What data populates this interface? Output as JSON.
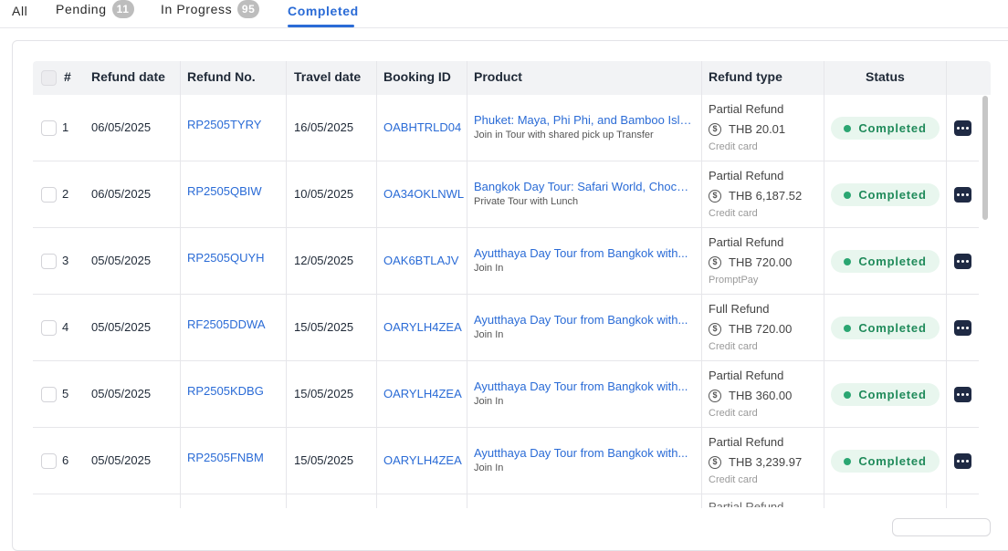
{
  "tabs": [
    {
      "label": "All",
      "count": null
    },
    {
      "label": "Pending",
      "count": "11"
    },
    {
      "label": "In Progress",
      "count": "95"
    },
    {
      "label": "Completed",
      "count": null
    }
  ],
  "active_tab": "Completed",
  "table": {
    "headers": [
      "#",
      "Refund date",
      "Refund No.",
      "Travel date",
      "Booking ID",
      "Product",
      "Refund type",
      "Status"
    ],
    "rows": [
      {
        "num": "1",
        "refund_date": "06/05/2025",
        "refund_no": "RP2505TYRY",
        "travel_date": "16/05/2025",
        "booking_id": "OABHTRLD04",
        "product_title": "Phuket: Maya, Phi Phi, and Bamboo Islan...",
        "product_sub": "Join in Tour with shared pick up Transfer",
        "refund_type": "Partial Refund",
        "amount": "THB 20.01",
        "method": "Credit card",
        "status": "Completed"
      },
      {
        "num": "2",
        "refund_date": "06/05/2025",
        "refund_no": "RP2505QBIW",
        "travel_date": "10/05/2025",
        "booking_id": "OA34OKLNWL",
        "product_title": "Bangkok Day Tour: Safari World, Chocola...",
        "product_sub": "Private Tour with Lunch",
        "refund_type": "Partial Refund",
        "amount": "THB 6,187.52",
        "method": "Credit card",
        "status": "Completed"
      },
      {
        "num": "3",
        "refund_date": "05/05/2025",
        "refund_no": "RP2505QUYH",
        "travel_date": "12/05/2025",
        "booking_id": "OAK6BTLAJV",
        "product_title": "Ayutthaya Day Tour from Bangkok with...",
        "product_sub": "Join In",
        "refund_type": "Partial Refund",
        "amount": "THB 720.00",
        "method": "PromptPay",
        "status": "Completed"
      },
      {
        "num": "4",
        "refund_date": "05/05/2025",
        "refund_no": "RF2505DDWA",
        "travel_date": "15/05/2025",
        "booking_id": "OARYLH4ZEA",
        "product_title": "Ayutthaya Day Tour from Bangkok with...",
        "product_sub": "Join In",
        "refund_type": "Full Refund",
        "amount": "THB 720.00",
        "method": "Credit card",
        "status": "Completed"
      },
      {
        "num": "5",
        "refund_date": "05/05/2025",
        "refund_no": "RP2505KDBG",
        "travel_date": "15/05/2025",
        "booking_id": "OARYLH4ZEA",
        "product_title": "Ayutthaya Day Tour from Bangkok with...",
        "product_sub": "Join In",
        "refund_type": "Partial Refund",
        "amount": "THB 360.00",
        "method": "Credit card",
        "status": "Completed"
      },
      {
        "num": "6",
        "refund_date": "05/05/2025",
        "refund_no": "RP2505FNBM",
        "travel_date": "15/05/2025",
        "booking_id": "OARYLH4ZEA",
        "product_title": "Ayutthaya Day Tour from Bangkok with...",
        "product_sub": "Join In",
        "refund_type": "Partial Refund",
        "amount": "THB 3,239.97",
        "method": "Credit card",
        "status": "Completed"
      }
    ],
    "peek_refund_type": "Partial Refund"
  },
  "icons": {
    "currency": "dollar-coin-icon",
    "more": "more-horizontal-icon"
  },
  "colors": {
    "accent": "#2a6bd6",
    "status_bg": "#e8f6ee",
    "status_text": "#1f8a5a",
    "more_button": "#1f2a44"
  }
}
